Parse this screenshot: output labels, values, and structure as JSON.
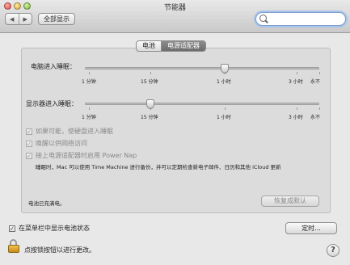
{
  "window": {
    "title": "节能器"
  },
  "toolbar": {
    "back": "◀",
    "forward": "▶",
    "show_all": "全部显示",
    "search_placeholder": ""
  },
  "tabs": [
    {
      "label": "电池",
      "active": false
    },
    {
      "label": "电源适配器",
      "active": true
    }
  ],
  "computer_sleep": {
    "label": "电脑进入睡眠：",
    "ticks": [
      "1 分钟",
      "15 分钟",
      "1 小时",
      "3 小时",
      "永不"
    ],
    "value": "1 小时"
  },
  "display_sleep": {
    "label": "显示器进入睡眠：",
    "ticks": [
      "1 分钟",
      "15 分钟",
      "1 小时",
      "3 小时",
      "永不"
    ],
    "value": "15 分钟"
  },
  "options": [
    {
      "label": "如果可能，使硬盘进入睡眠",
      "checked": true,
      "enabled": false
    },
    {
      "label": "唤醒以供网络访问",
      "checked": true,
      "enabled": false
    },
    {
      "label": "接上电源适配器时启用 Power Nap",
      "checked": true,
      "enabled": false
    }
  ],
  "power_nap_desc": "睡眠时，Mac 可以使用 Time Machine 进行备份，并可以定期检查新电子邮件、日历和其他 iCloud 更新",
  "battery_status": "电池已充满电。",
  "restore_defaults": "恢复成默认",
  "show_battery_status": {
    "label": "在菜单栏中显示电池状态",
    "checked": true
  },
  "schedule_button": "定时...",
  "lock_text": "点按锁按钮以进行更改。",
  "help": "?"
}
